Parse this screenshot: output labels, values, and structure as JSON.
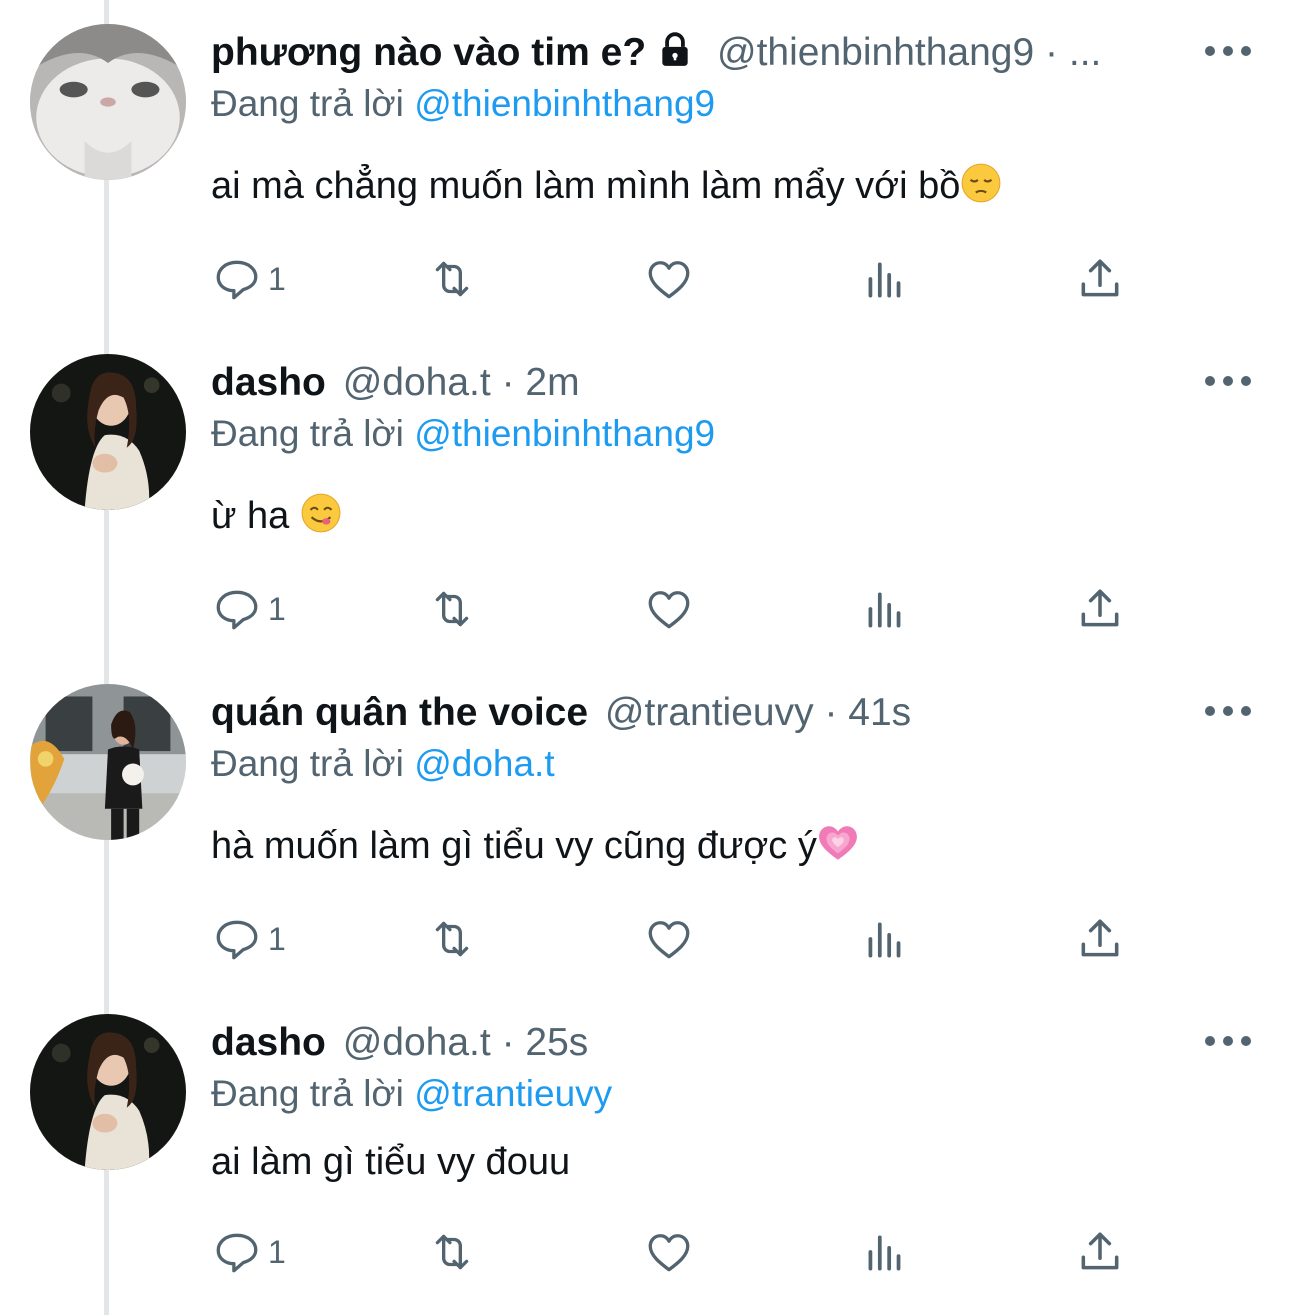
{
  "tweets": [
    {
      "display_name": "phương nào vào tim e?",
      "handle": "@thienbinhthang9",
      "time": "· ...",
      "replying_label": "Đang trả lời",
      "replying_to": "@thienbinhthang9",
      "text": "ai mà chẳng muốn làm mình làm mẩy với bồ",
      "emoji": "pensive-face",
      "reply_count": "1",
      "protected": true
    },
    {
      "display_name": "dasho",
      "handle": "@doha.t",
      "time": "· 2m",
      "replying_label": "Đang trả lời",
      "replying_to": "@thienbinhthang9",
      "text": "ừ ha ",
      "emoji": "yum-face",
      "reply_count": "1"
    },
    {
      "display_name": "quán quân the voice",
      "handle": "@trantieuvy",
      "time": "· 41s",
      "replying_label": "Đang trả lời",
      "replying_to": "@doha.t",
      "text": "hà muốn làm gì tiểu vy cũng được ý",
      "emoji": "growing-heart",
      "reply_count": "1"
    },
    {
      "display_name": "dasho",
      "handle": "@doha.t",
      "time": "· 25s",
      "replying_label": "Đang trả lời",
      "replying_to": "@trantieuvy",
      "text": "ai làm gì tiểu vy đouu",
      "emoji": null,
      "reply_count": "1"
    }
  ],
  "colors": {
    "text": "#0f1419",
    "secondary": "#536471",
    "mention": "#1d9bf0",
    "thread_line": "#e2e6e9"
  },
  "icons": [
    "reply-icon",
    "retweet-icon",
    "like-icon",
    "analytics-icon",
    "share-icon",
    "more-icon",
    "lock-icon"
  ]
}
